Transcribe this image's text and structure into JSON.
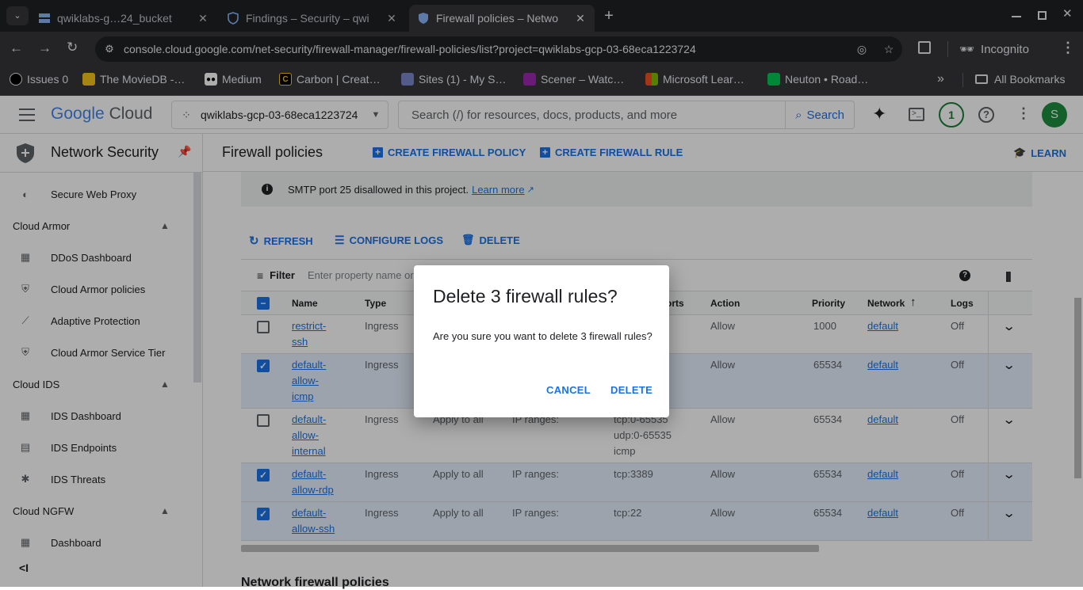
{
  "browser": {
    "tabs": [
      {
        "title": "qwiklabs-g…24_bucket",
        "active": false
      },
      {
        "title": "Findings – Security – qwi",
        "active": false
      },
      {
        "title": "Firewall policies – Netwo",
        "active": true
      }
    ],
    "url": "console.cloud.google.com/net-security/firewall-manager/firewall-policies/list?project=qwiklabs-gcp-03-68eca1223724",
    "incognito_label": "Incognito",
    "bookmarks": [
      "Issues 0",
      "The MovieDB -…",
      "Medium",
      "Carbon | Creat…",
      "Sites (1) - My S…",
      "Scener – Watc…",
      "Microsoft Lear…",
      "Neuton • Road…"
    ],
    "all_bookmarks": "All Bookmarks"
  },
  "header": {
    "logo_google": "Google",
    "logo_cloud": "Cloud",
    "project": "qwiklabs-gcp-03-68eca1223724",
    "search_placeholder": "Search (/) for resources, docs, products, and more",
    "search_button": "Search",
    "notification_count": "1",
    "avatar_letter": "S"
  },
  "sidebar": {
    "title": "Network Security",
    "items": [
      {
        "type": "item",
        "label": "Secure Web Proxy",
        "icon": "proxy-icon"
      },
      {
        "type": "section",
        "label": "Cloud Armor"
      },
      {
        "type": "item",
        "label": "DDoS Dashboard",
        "icon": "dashboard-icon"
      },
      {
        "type": "item",
        "label": "Cloud Armor policies",
        "icon": "shield-icon"
      },
      {
        "type": "item",
        "label": "Adaptive Protection",
        "icon": "chart-icon"
      },
      {
        "type": "item",
        "label": "Cloud Armor Service Tier",
        "icon": "shield-icon"
      },
      {
        "type": "section",
        "label": "Cloud IDS"
      },
      {
        "type": "item",
        "label": "IDS Dashboard",
        "icon": "dashboard-icon"
      },
      {
        "type": "item",
        "label": "IDS Endpoints",
        "icon": "endpoint-icon"
      },
      {
        "type": "item",
        "label": "IDS Threats",
        "icon": "threat-icon"
      },
      {
        "type": "section",
        "label": "Cloud NGFW"
      },
      {
        "type": "item",
        "label": "Dashboard",
        "icon": "dashboard-icon"
      }
    ]
  },
  "page": {
    "title": "Firewall policies",
    "create_policy": "CREATE FIREWALL POLICY",
    "create_rule": "CREATE FIREWALL RULE",
    "learn": "LEARN",
    "notice": "SMTP port 25 disallowed in this project.",
    "notice_link": "Learn more",
    "refresh": "REFRESH",
    "configure_logs": "CONFIGURE LOGS",
    "delete": "DELETE",
    "filter_label": "Filter",
    "filter_placeholder": "Enter property name or value",
    "next_section": "Network firewall policies"
  },
  "table": {
    "headers": {
      "name": "Name",
      "type": "Type",
      "ports": "orts",
      "action": "Action",
      "priority": "Priority",
      "network": "Network",
      "logs": "Logs"
    },
    "rows": [
      {
        "name": [
          "restrict-",
          "ssh"
        ],
        "type": "Ingress",
        "targets": "",
        "filters": "",
        "ports": [],
        "action": "Allow",
        "priority": "1000",
        "network": "default",
        "logs": "Off",
        "checked": false
      },
      {
        "name": [
          "default-",
          "allow-",
          "icmp"
        ],
        "type": "Ingress",
        "targets": "",
        "filters": "",
        "ports": [],
        "action": "Allow",
        "priority": "65534",
        "network": "default",
        "logs": "Off",
        "checked": true
      },
      {
        "name": [
          "default-",
          "allow-",
          "internal"
        ],
        "type": "Ingress",
        "targets": "Apply to all",
        "filters": "IP ranges:",
        "ports": [
          "tcp:0-65535",
          "udp:0-65535",
          "icmp"
        ],
        "action": "Allow",
        "priority": "65534",
        "network": "default",
        "logs": "Off",
        "checked": false
      },
      {
        "name": [
          "default-",
          "allow-rdp"
        ],
        "type": "Ingress",
        "targets": "Apply to all",
        "filters": "IP ranges:",
        "ports": [
          "tcp:3389"
        ],
        "action": "Allow",
        "priority": "65534",
        "network": "default",
        "logs": "Off",
        "checked": true
      },
      {
        "name": [
          "default-",
          "allow-ssh"
        ],
        "type": "Ingress",
        "targets": "Apply to all",
        "filters": "IP ranges:",
        "ports": [
          "tcp:22"
        ],
        "action": "Allow",
        "priority": "65534",
        "network": "default",
        "logs": "Off",
        "checked": true
      }
    ]
  },
  "dialog": {
    "title": "Delete 3 firewall rules?",
    "body": "Are you sure you want to delete 3 firewall rules?",
    "cancel": "CANCEL",
    "confirm": "DELETE"
  },
  "colors": {
    "accent": "#1a73e8",
    "selected_row": "#e8f0fe",
    "chrome_bg": "#202124"
  }
}
